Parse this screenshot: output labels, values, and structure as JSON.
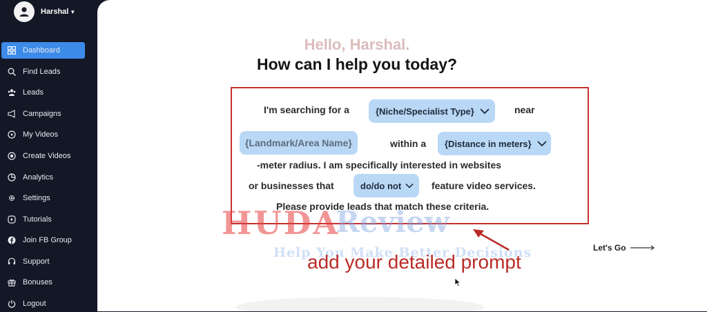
{
  "user": {
    "name": "Harshal"
  },
  "sidebar": {
    "items": [
      {
        "label": "Dashboard",
        "icon": "grid-icon",
        "active": true
      },
      {
        "label": "Find Leads",
        "icon": "search-icon"
      },
      {
        "label": "Leads",
        "icon": "users-icon"
      },
      {
        "label": "Campaigns",
        "icon": "megaphone-icon"
      },
      {
        "label": "My Videos",
        "icon": "play-circle-icon"
      },
      {
        "label": "Create Videos",
        "icon": "record-icon"
      },
      {
        "label": "Analytics",
        "icon": "pie-chart-icon"
      },
      {
        "label": "Settings",
        "icon": "gear-icon"
      },
      {
        "label": "Tutorials",
        "icon": "tutorial-icon"
      },
      {
        "label": "Join FB Group",
        "icon": "facebook-icon"
      },
      {
        "label": "Support",
        "icon": "headset-icon"
      },
      {
        "label": "Bonuses",
        "icon": "gift-icon"
      },
      {
        "label": "Logout",
        "icon": "logout-icon"
      }
    ]
  },
  "main": {
    "greeting": "Hello, Harshal.",
    "headline": "How can I help you today?",
    "prompt": {
      "line1_text": "I'm searching for a",
      "niche_select": "{Niche/Specialist Type}",
      "near_text": "near",
      "landmark_input": "{Landmark/Area Name}",
      "within_text": "within a",
      "distance_select": "{Distance in meters}",
      "line3_text": "-meter radius. I am specifically interested in websites",
      "line4_text": "or businesses that",
      "do_select": "do/do not",
      "feature_text": "feature video services.",
      "line5_text": "Please provide leads that match these criteria."
    },
    "lets_go_label": "Let's Go"
  },
  "watermark": {
    "brand_part1": "HUDA",
    "brand_part2": "Review",
    "tagline": "Help You Make Better Decisions"
  },
  "annotation": {
    "text": "add your detailed prompt",
    "color": "#b92b27"
  },
  "colors": {
    "accent": "#3d8be8",
    "pill": "#b9d8f6",
    "sidebar": "#131726",
    "box_border": "#c62f2f"
  }
}
